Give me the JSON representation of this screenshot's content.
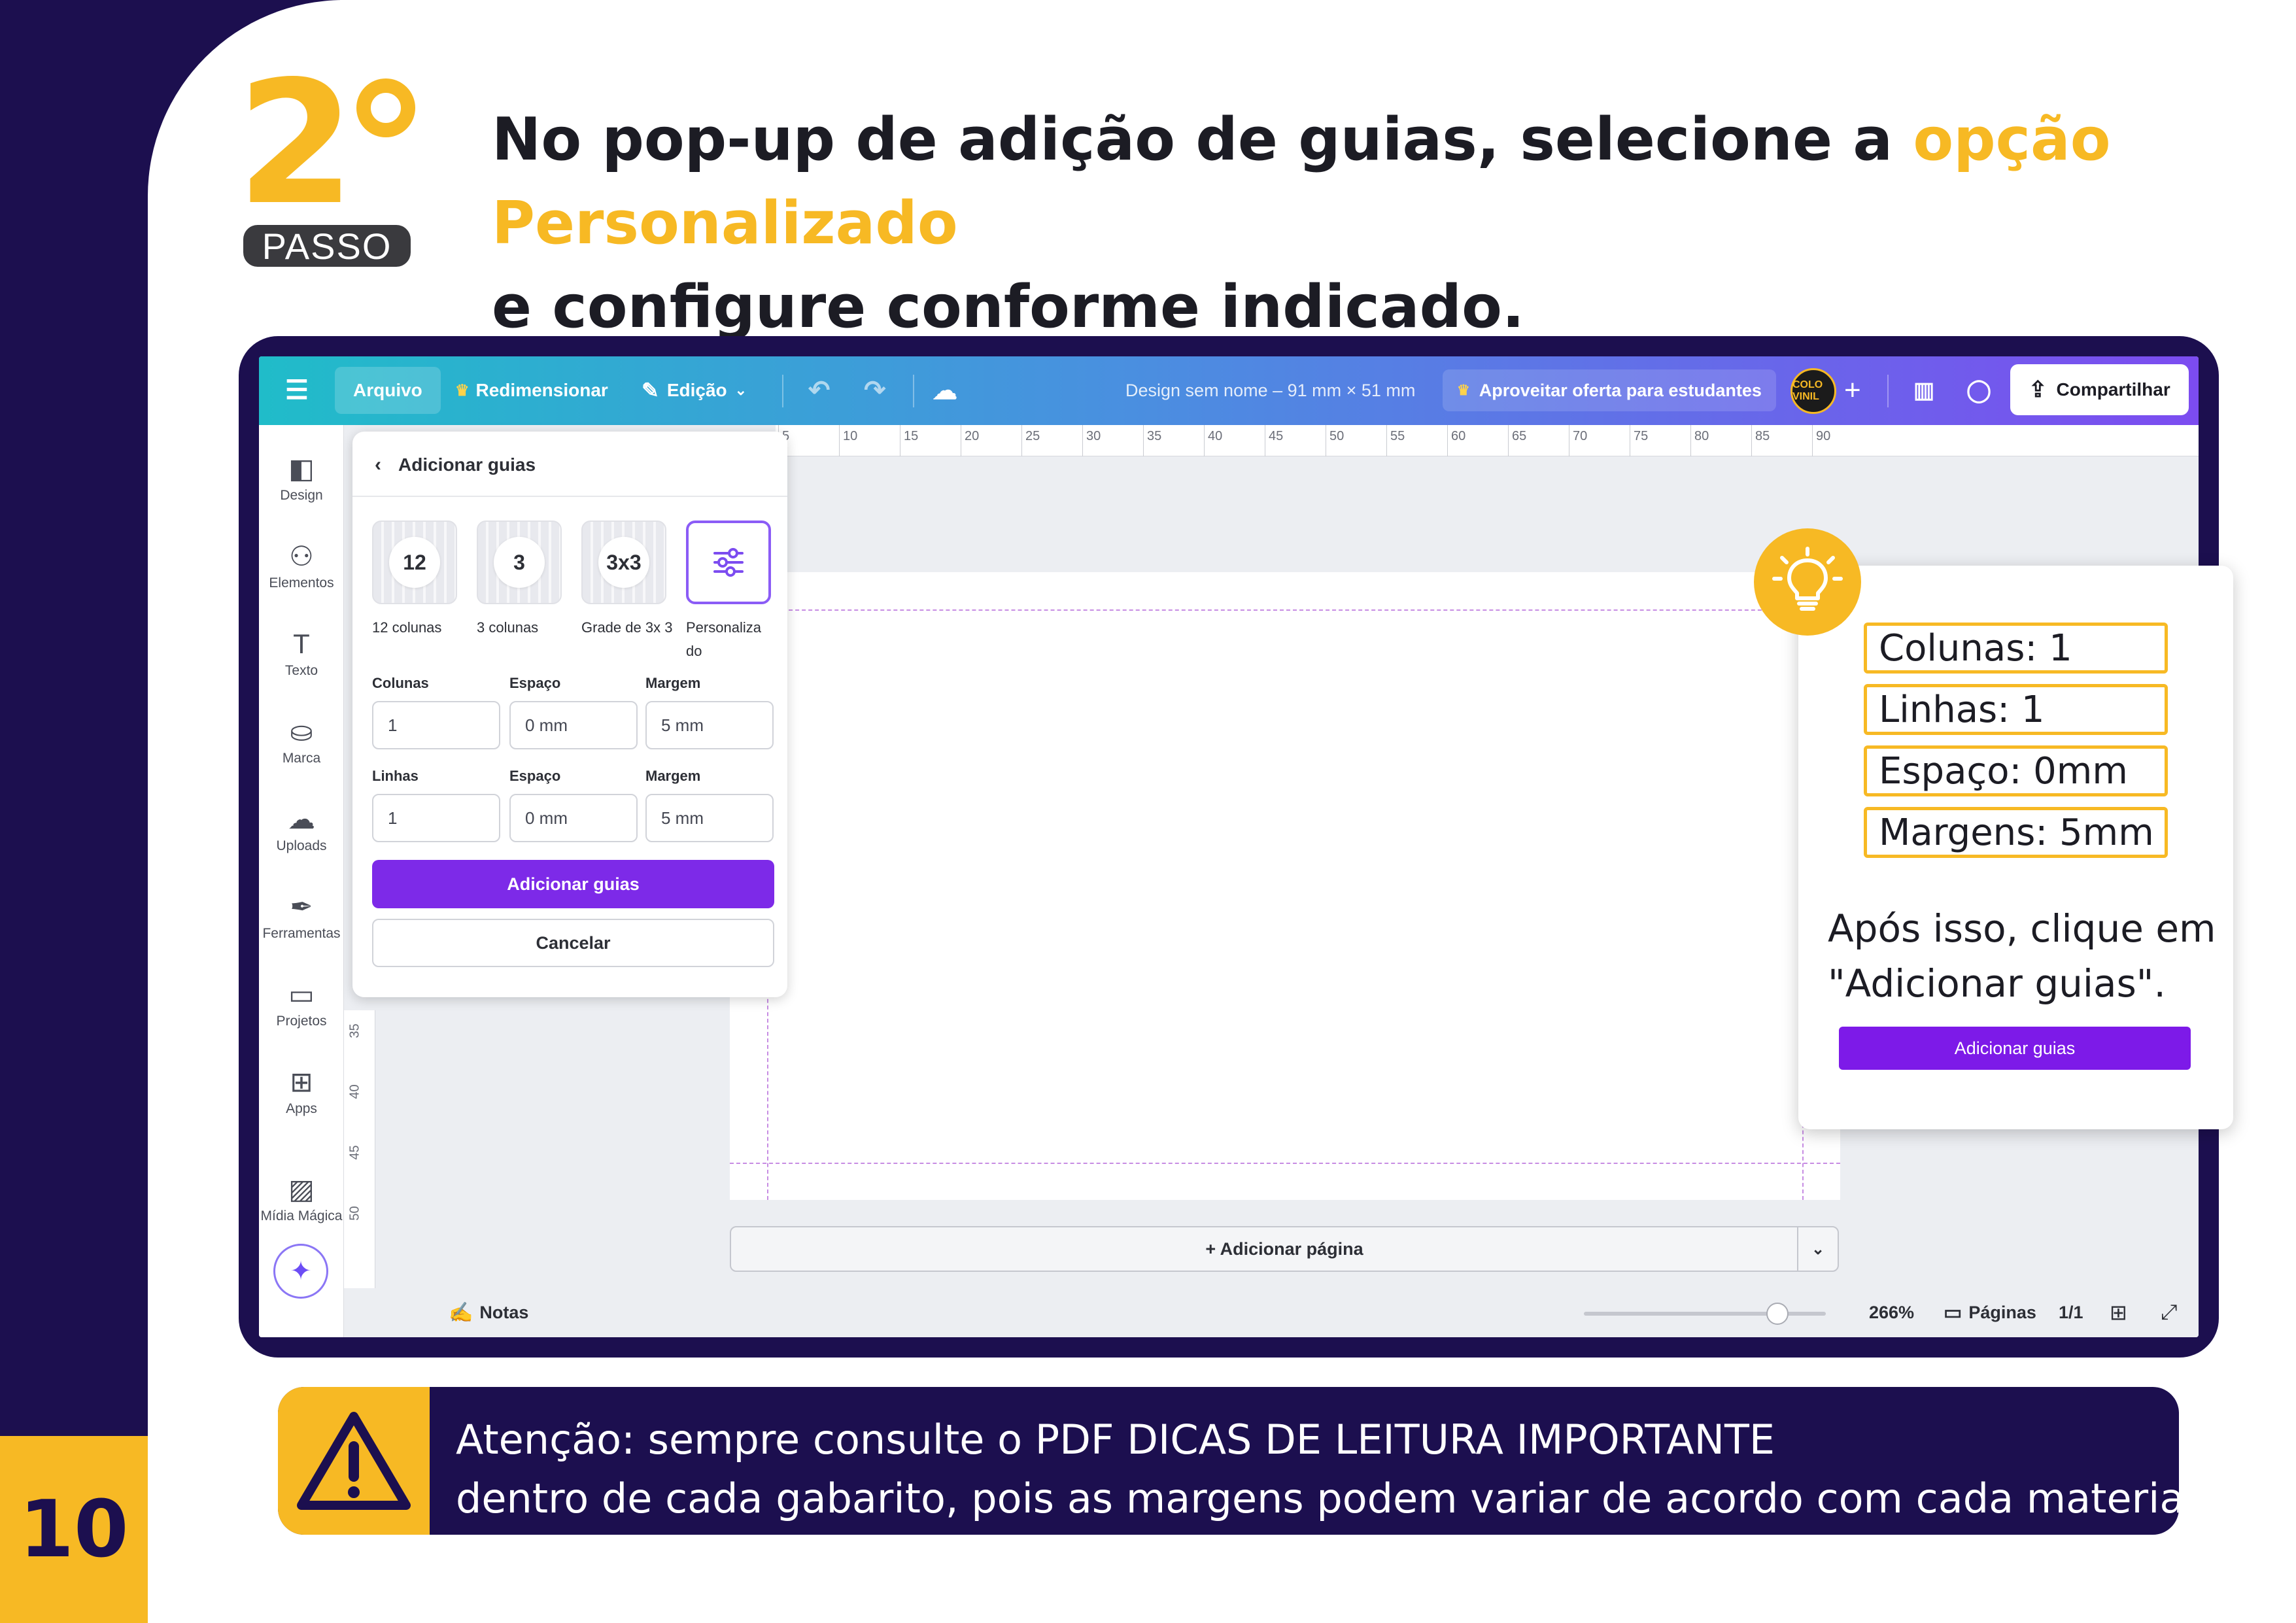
{
  "page": {
    "number": "10",
    "step_number": "2",
    "step_label": "PASSO",
    "headline_part1": "No pop-up de adição de guias, selecione a ",
    "headline_highlight": "opção Personalizado",
    "headline_part2": "e configure conforme indicado.",
    "accent_color": "#f7b924",
    "dark_color": "#1c0f4f"
  },
  "toolbar": {
    "menu_icon": "hamburger-icon",
    "file_label": "Arquivo",
    "resize_label": "Redimensionar",
    "edit_label": "Edição",
    "design_title": "Design sem nome – 91 mm × 51 mm",
    "offer_label": "Aproveitar oferta para estudantes",
    "avatar_text": "COLO VINIL",
    "share_label": "Compartilhar"
  },
  "rail": {
    "items": [
      {
        "label": "Design",
        "icon": "layout-icon"
      },
      {
        "label": "Elementos",
        "icon": "shapes-icon"
      },
      {
        "label": "Texto",
        "icon": "text-icon"
      },
      {
        "label": "Marca",
        "icon": "brand-icon"
      },
      {
        "label": "Uploads",
        "icon": "upload-cloud-icon"
      },
      {
        "label": "Ferramentas",
        "icon": "pen-tool-icon"
      },
      {
        "label": "Projetos",
        "icon": "folder-icon"
      },
      {
        "label": "Apps",
        "icon": "apps-icon"
      },
      {
        "label": "Mídia Mágica",
        "icon": "magic-media-icon"
      }
    ]
  },
  "ruler": {
    "top_ticks": [
      "5",
      "10",
      "15",
      "20",
      "25",
      "30",
      "35",
      "40",
      "45",
      "50",
      "55",
      "60",
      "65",
      "70",
      "75",
      "80",
      "85",
      "90"
    ],
    "left_ticks": [
      "35",
      "40",
      "45",
      "50"
    ]
  },
  "panel": {
    "title": "Adicionar guias",
    "options": [
      {
        "icon_text": "12",
        "label": "12 colunas"
      },
      {
        "icon_text": "3",
        "label": "3 colunas"
      },
      {
        "icon_text": "3x3",
        "label": "Grade de 3x 3"
      },
      {
        "icon_text": "⚙",
        "label": "Personaliza do"
      }
    ],
    "columns_label": "Colunas",
    "columns_value": "1",
    "columns_gap_label": "Espaço",
    "columns_gap_value": "0 mm",
    "columns_margin_label": "Margem",
    "columns_margin_value": "5 mm",
    "rows_label": "Linhas",
    "rows_value": "1",
    "rows_gap_label": "Espaço",
    "rows_gap_value": "0 mm",
    "rows_margin_label": "Margem",
    "rows_margin_value": "5 mm",
    "add_button": "Adicionar guias",
    "cancel_button": "Cancelar"
  },
  "canvas": {
    "add_page_label": "+ Adicionar página"
  },
  "bottombar": {
    "notes_label": "Notas",
    "zoom_level": "266%",
    "zoom_fraction": 0.8,
    "pages_label": "Páginas",
    "page_count": "1/1"
  },
  "callout": {
    "settings": [
      "Colunas: 1",
      "Linhas: 1",
      "Espaço: 0mm",
      "Margens: 5mm"
    ],
    "instruction": "Após isso, clique em \"Adicionar guias\".",
    "button_label": "Adicionar guias"
  },
  "warning": {
    "line1": "Atenção: sempre consulte o PDF DICAS DE LEITURA IMPORTANTE",
    "line2": "dentro de cada gabarito, pois as margens podem variar de acordo com cada material."
  }
}
